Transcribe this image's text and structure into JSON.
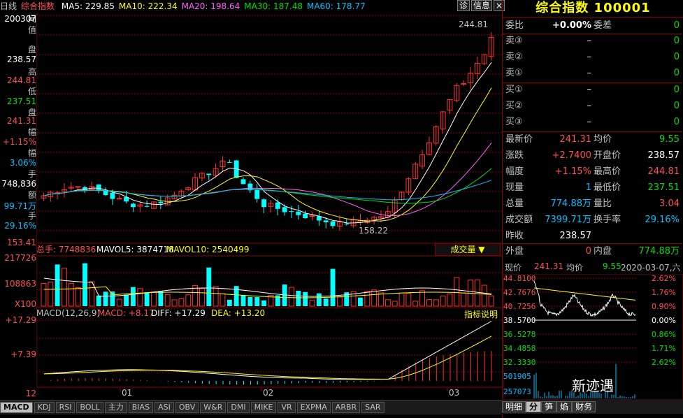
{
  "top": {
    "period": "日线",
    "name": "综合指数",
    "ma": [
      {
        "label": "MA5:",
        "value": "229.85",
        "color": "#ffffff"
      },
      {
        "label": "MA10:",
        "value": "222.34",
        "color": "#ffff00"
      },
      {
        "label": "MA20:",
        "value": "198.64",
        "color": "#ff60ff"
      },
      {
        "label": "MA30:",
        "value": "187.48",
        "color": "#00e000"
      },
      {
        "label": "MA60:",
        "value": "178.77",
        "color": "#00c0ff"
      }
    ],
    "btn_info1": "诊",
    "btn_info2": "信息",
    "btn_close": "×"
  },
  "left_axis": {
    "time_label": "间",
    "date": "200307",
    "value_label": "值",
    "open_label": "盘",
    "open": "238.57",
    "high_label": "高",
    "high": "244.81",
    "low_label": "低",
    "low": "237.51",
    "close_label": "盘",
    "close": "241.31",
    "chg_label": "幅",
    "chg": "+1.15%",
    "amp_label": "幅",
    "amp": "3.06%",
    "vol_label": "手",
    "vol": "748,836",
    "amt_label": "额",
    "amt": "99.71万",
    "turn_label": "手",
    "turn": "29.16%",
    "price_bottom": "153.41",
    "vol_max": "217726",
    "vol_mid": "108863",
    "vol_unit": "X100",
    "macd_top": "+17.29",
    "macd_mid": "+7.39",
    "year": "12"
  },
  "annotations": {
    "high_mark": "244.81",
    "low_mark": "158.22"
  },
  "volume_bar": {
    "total": "总手: 7748836",
    "mavol5": "MAVOL5: 3874718",
    "mavol10": "MAVOL10: 2540499",
    "button": "成交量 ▼"
  },
  "macd_bar": {
    "title": "MACD(12,26,9)",
    "macd": "MACD: +8.17",
    "diff": "DIFF: +17.29",
    "dea": "DEA: +13.20",
    "button": "指标说明"
  },
  "x_labels": [
    "01",
    "02",
    "03"
  ],
  "bottom_tabs": [
    "MACD",
    "KDJ",
    "RSI",
    "BOLL",
    "主力",
    "BIAS",
    "ASI",
    "OBV",
    "W&R",
    "DMI",
    "MIKE",
    "VR",
    "EXPMA",
    "ARBR",
    "SAR"
  ],
  "right": {
    "title": "综合指数 100001",
    "weibi": {
      "label": "委比",
      "value": "+0.00%",
      "label2": "委差",
      "value2": "0"
    },
    "sells": [
      {
        "label": "卖③",
        "price": "–",
        "vol": "0"
      },
      {
        "label": "卖②",
        "price": "–",
        "vol": "0"
      },
      {
        "label": "卖①",
        "price": "–",
        "vol": "0"
      }
    ],
    "buys": [
      {
        "label": "买①",
        "price": "–",
        "vol": "0"
      },
      {
        "label": "买②",
        "price": "–",
        "vol": "0"
      },
      {
        "label": "买③",
        "price": "–",
        "vol": "0"
      }
    ],
    "quote": [
      {
        "l1": "最新价",
        "v1": "241.31",
        "c1": "red",
        "l2": "均价",
        "v2": "9.55",
        "c2": "grn"
      },
      {
        "l1": "涨跌",
        "v1": "+2.7400",
        "c1": "red",
        "l2": "开盘价",
        "v2": "238.57",
        "c2": "wht"
      },
      {
        "l1": "幅度",
        "v1": "+1.15%",
        "c1": "red",
        "l2": "最高价",
        "v2": "244.81",
        "c2": "red"
      },
      {
        "l1": "现量",
        "v1": "1",
        "c1": "cyan",
        "l2": "最低价",
        "v2": "237.51",
        "c2": "grn"
      },
      {
        "l1": "总量",
        "v1": "774.88万",
        "c1": "cyan",
        "l2": "量比",
        "v2": "3.04",
        "c2": "red"
      },
      {
        "l1": "成交额",
        "v1": "7399.71万",
        "c1": "cyan",
        "l2": "换手率",
        "v2": "29.16%",
        "c2": "cyan"
      },
      {
        "l1": "昨收",
        "v1": "238.57",
        "c1": "wht",
        "l2": "",
        "v2": "",
        "c2": "wht"
      }
    ],
    "outer": {
      "label": "外盘",
      "value": "0",
      "label2": "内盘",
      "value2": "774.88万"
    },
    "mini_header": {
      "now_label": "现价",
      "now": "241.31",
      "avg_label": "均价",
      "avg": "9.55",
      "date": "2020-03-07,六"
    },
    "mini_left": [
      "44.8100",
      "42.7676",
      "40.7256",
      "38.5700",
      "36.5278",
      "34.4858",
      "32.3330",
      "501905",
      "257073"
    ],
    "mini_right": [
      "2.62%",
      "1.76%",
      "0.90%",
      "0.00%",
      "0.86%",
      "1.71%",
      "2.62%"
    ],
    "tabs": [
      "明细",
      "分",
      "笋",
      "焰",
      "财务"
    ],
    "watermark": "新迹遇"
  },
  "chart_data": {
    "type": "candlestick",
    "x_ticks": [
      "01",
      "02",
      "03"
    ],
    "price_range": [
      153.41,
      248.0
    ],
    "high": 244.81,
    "low": 158.22,
    "volume_range": [
      0,
      217726
    ],
    "macd_range": [
      -2,
      17.29
    ],
    "macd_ticks": [
      17.29,
      7.39
    ]
  }
}
